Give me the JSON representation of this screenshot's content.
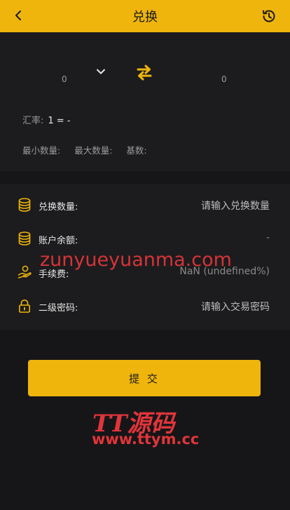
{
  "header": {
    "title": "兑换",
    "back_icon": "chevron-left-icon",
    "history_icon": "history-clock-icon",
    "background": "#efb50c"
  },
  "exchange": {
    "from_amount": "0",
    "to_amount": "0",
    "dropdown_icon": "chevron-down-icon",
    "swap_icon": "swap-arrows-icon",
    "rate_label": "汇率:",
    "rate_value": "1 = -",
    "min_label": "最小数量:",
    "max_label": "最大数量:",
    "base_label": "基数:"
  },
  "form": {
    "rows": [
      {
        "icon": "coins-stack-icon",
        "label": "兑换数量:",
        "value": "请输入兑换数量"
      },
      {
        "icon": "coins-stack-icon",
        "label": "账户余额:",
        "value": "-"
      },
      {
        "icon": "fee-hand-icon",
        "label": "手续费:",
        "value": "NaN (undefined%)"
      },
      {
        "icon": "lock-icon",
        "label": "二级密码:",
        "value": "请输入交易密码"
      }
    ]
  },
  "submit_label": "提 交",
  "watermarks": {
    "domain": "zunyueyuanma.com",
    "brand": "TT源码",
    "url": "www.ttym.cc"
  },
  "colors": {
    "accent": "#efb50c",
    "background": "#161618",
    "panel": "#1c1c1e",
    "watermark": "#e0353a"
  }
}
